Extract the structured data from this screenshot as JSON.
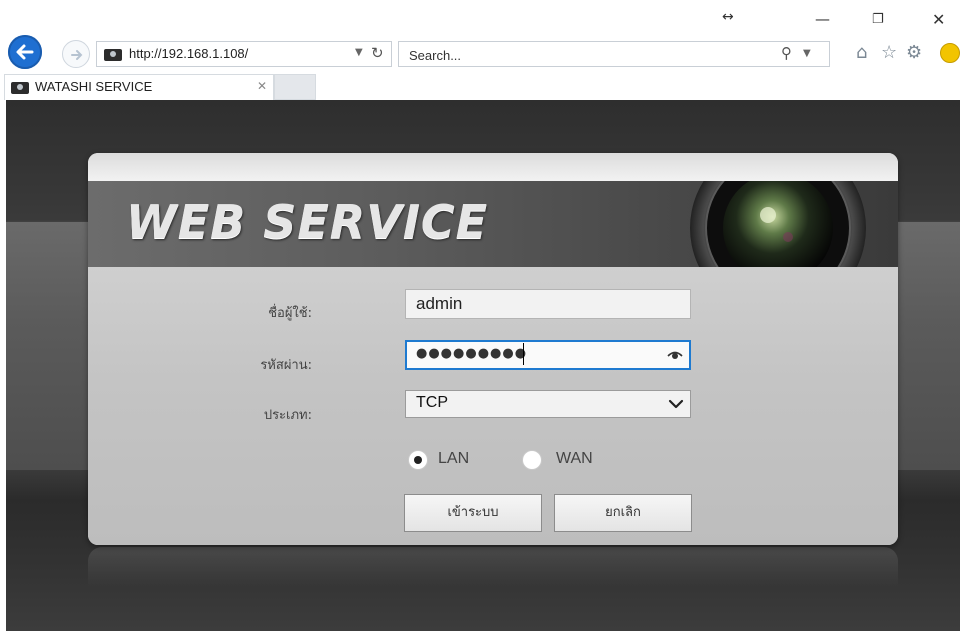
{
  "browser": {
    "address_url": "http://192.168.1.108/",
    "search_placeholder": "Search...",
    "tab_title": "WATASHI SERVICE",
    "icons": [
      "back-arrow-icon",
      "forward-arrow-icon",
      "refresh-icon",
      "search-icon",
      "home-icon",
      "star-icon",
      "gear-icon",
      "smiley-icon",
      "close-icon",
      "minimize-icon",
      "restore-icon"
    ]
  },
  "page": {
    "banner_title": "WEB  SERVICE",
    "form": {
      "username_label": "ชื่อผู้ใช้:",
      "username_value": "admin",
      "password_label": "รหัสผ่าน:",
      "password_masked": "●●●●●●●●●",
      "type_label": "ประเภท:",
      "type_value": "TCP",
      "radio_lan": "LAN",
      "radio_wan": "WAN",
      "selected_network": "LAN",
      "login_button": "เข้าระบบ",
      "cancel_button": "ยกเลิก"
    }
  },
  "colors": {
    "back_button": "#1f6fd1",
    "focus_border": "#1e7ad0",
    "banner_dark": "#3a3a3a"
  }
}
